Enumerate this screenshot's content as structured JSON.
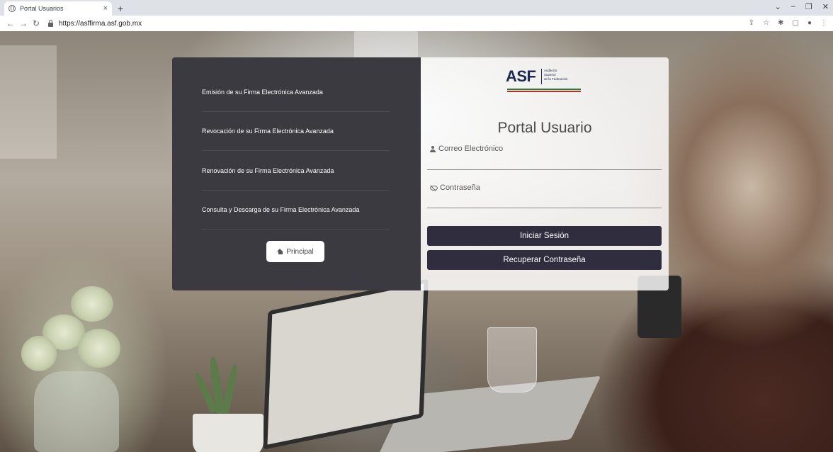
{
  "browser": {
    "tab_title": "Portal Usuarios",
    "tab_close": "×",
    "new_tab": "+",
    "url": "https://asffirma.asf.gob.mx",
    "window_controls": [
      "⌄",
      "–",
      "❐",
      "✕"
    ]
  },
  "menu": {
    "items": [
      {
        "label": "Emisión de su Firma Electrónica Avanzada"
      },
      {
        "label": "Revocación de su Firma Electrónica Avanzada"
      },
      {
        "label": "Renovación de su Firma Electrónica Avanzada"
      },
      {
        "label": "Consulta y Descarga de su Firma Electrónica Avanzada"
      }
    ],
    "principal_label": "Principal"
  },
  "logo": {
    "text": "ASF",
    "line1": "Auditoría",
    "line2": "Superior",
    "line3": "de la Federación"
  },
  "login": {
    "title": "Portal Usuario",
    "email_label": "Correo Electrónico",
    "password_label": "Contraseña",
    "login_button": "Iniciar Sesión",
    "recover_button": "Recuperar Contraseña"
  },
  "colors": {
    "panel_dark": "#3a3a40",
    "button_dark": "#2f2d3e",
    "logo_blue": "#1d2a55"
  }
}
